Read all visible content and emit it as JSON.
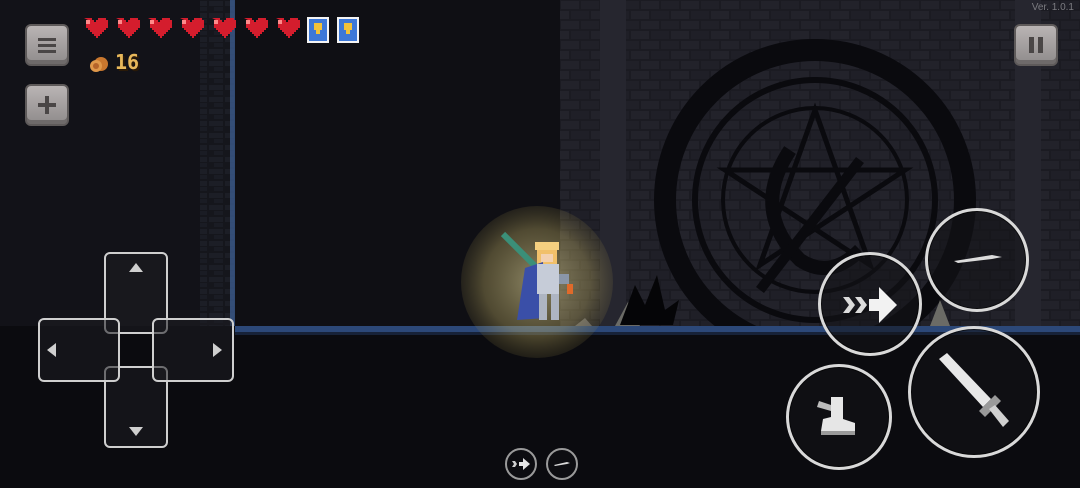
{
  "hud": {
    "hearts": 7,
    "shields": 2,
    "coin_count": "16",
    "version": "Ver. 1.0.1"
  },
  "buttons": {
    "menu": "menu-button",
    "add": "add-button",
    "pause": "pause-button",
    "dash": "dash-button",
    "throw": "throw-button",
    "jump": "jump-button",
    "attack": "attack-button",
    "mini_dash": "mini-dash-button",
    "mini_throw": "mini-throw-button"
  },
  "colors": {
    "heart": "#d41d2d",
    "shield": "#3d78d8",
    "coin_text": "#e8b85a",
    "glow": "#e8d88a"
  }
}
